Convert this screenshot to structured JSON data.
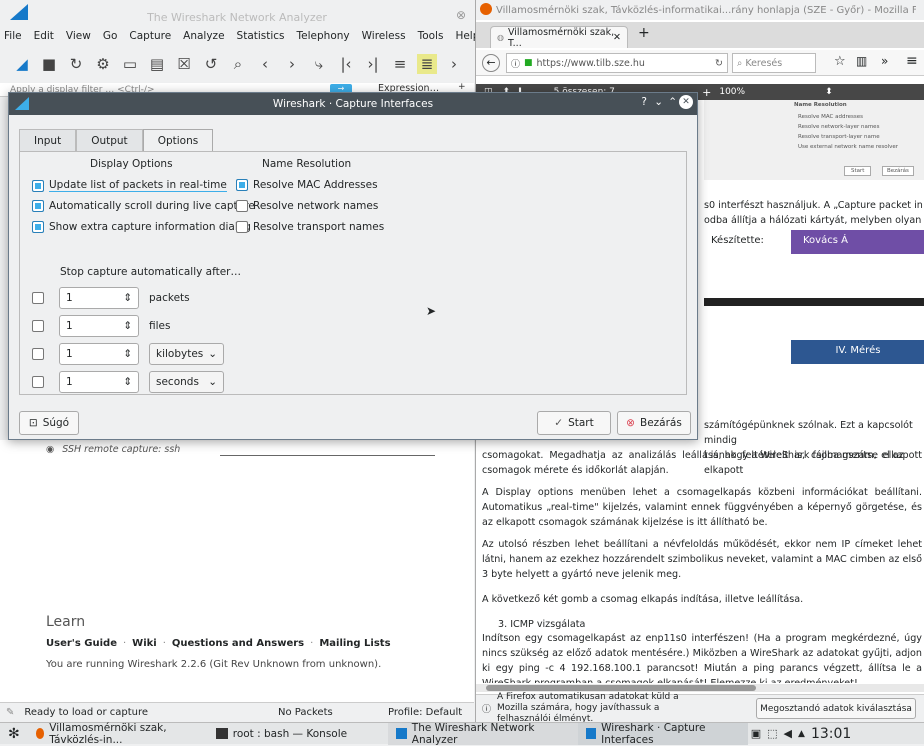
{
  "wireshark": {
    "title": "The Wireshark Network Analyzer",
    "menu": [
      "File",
      "Edit",
      "View",
      "Go",
      "Capture",
      "Analyze",
      "Statistics",
      "Telephony",
      "Wireless",
      "Tools",
      "Help"
    ],
    "filter_placeholder": "Apply a display filter … <Ctrl-/>",
    "expression_label": "Expression…",
    "ssh_item": "SSH remote capture: ssh",
    "learn": {
      "heading": "Learn",
      "links": [
        "User's Guide",
        "Wiki",
        "Questions and Answers",
        "Mailing Lists"
      ],
      "sep": "·",
      "version": "You are running Wireshark 2.2.6 (Git Rev Unknown from unknown)."
    },
    "status": {
      "left": "Ready to load or capture",
      "mid": "No Packets",
      "right": "Profile: Default"
    }
  },
  "dialog": {
    "title": "Wireshark · Capture Interfaces",
    "tabs": [
      "Input",
      "Output",
      "Options"
    ],
    "display_options": {
      "heading": "Display Options",
      "items": [
        {
          "label": "Update list of packets in real-time",
          "checked": true
        },
        {
          "label": "Automatically scroll during live capture",
          "checked": true
        },
        {
          "label": "Show extra capture information dialog",
          "checked": true
        }
      ]
    },
    "name_resolution": {
      "heading": "Name Resolution",
      "items": [
        {
          "label": "Resolve MAC Addresses",
          "checked": true
        },
        {
          "label": "Resolve network names",
          "checked": false
        },
        {
          "label": "Resolve transport names",
          "checked": false
        }
      ]
    },
    "stop": {
      "heading": "Stop capture automatically after…",
      "rows": [
        {
          "value": "1",
          "unit": "packets"
        },
        {
          "value": "1",
          "unit": "files"
        },
        {
          "value": "1",
          "unit": "kilobytes"
        },
        {
          "value": "1",
          "unit": "seconds"
        }
      ]
    },
    "help_label": "Súgó",
    "start_label": "Start",
    "close_label": "Bezárás"
  },
  "firefox": {
    "title": "Villamosmérnöki szak, Távközlés-informatikai...rány honlapja (SZE - Győr) - Mozilla Firefox",
    "tab_label": "Villamosmérnöki szak, T...",
    "url": "https://www.tilb.sze.hu",
    "search_placeholder": "Keresés",
    "page_info": "5 összesen: 7",
    "zoom": "100%",
    "mini": {
      "heading": "Name Resolution",
      "items": [
        "Resolve MAC addresses",
        "Resolve network-layer names",
        "Resolve transport-layer name",
        "Use external network name resolver"
      ],
      "start": "Start",
      "close": "Bezárás"
    },
    "frag1": "s0 interfészt használjuk. A „Capture packet in",
    "frag2": "odba állítja a hálózati kártyát, melyben olyan",
    "author_label": "Készítette:",
    "author": "Kovács Á",
    "banner": "IV. Mérés",
    "p1a": "számítógépünknek szólnak. Ezt a kapcsolót mindig",
    "p1b": "t is, hogy a WireShark fájlba mentse el az elkapott",
    "p1c": "csomagokat. Megadhatja az analizálás leállásának feltételeit is, csomagszám, elkapott csomagok mérete és időkorlát alapján.",
    "p2": "A Display options menüben lehet a csomagelkapás közbeni információkat beállítani. Automatikus „real-time\" kijelzés, valamint ennek függvényében a képernyő görgetése, és az elkapott csomagok számának kijelzése is itt állítható be.",
    "p3": "Az utolsó részben lehet beállítani a névfeloldás működését, ekkor nem IP címeket lehet látni, hanem az ezekhez hozzárendelt szimbolikus neveket, valamint a MAC cimben az első 3 byte helyett a gyártó neve jelenik meg.",
    "p4": "A következő két gomb a csomag elkapás indítása, illetve leállítása.",
    "p5_title": "3.   ICMP vizsgálata",
    "p5": "Indítson egy csomagelkapást az enp11s0 interfészen! (Ha a program megkérdezné, úgy nincs szükség az előző adatok mentésére.) Miközben a WireShark az adatokat gyűjti, adjon ki egy ping -c 4 192.168.100.1 parancsot! Miután a ping parancs végzett, állítsa le a WireShark programban a csomagok elkapását! Elemezze ki az eredményeket!",
    "notice": "A Firefox automatikusan adatokat küld a Mozilla számára, hogy javíthassuk a felhasználói élményt.",
    "notice_button": "Megosztandó adatok kiválasztása"
  },
  "taskbar": {
    "items": [
      "Villamosmérnöki szak, Távközlés-in...",
      "root : bash — Konsole",
      "The Wireshark Network Analyzer",
      "Wireshark · Capture Interfaces"
    ],
    "clock": "13:01"
  }
}
